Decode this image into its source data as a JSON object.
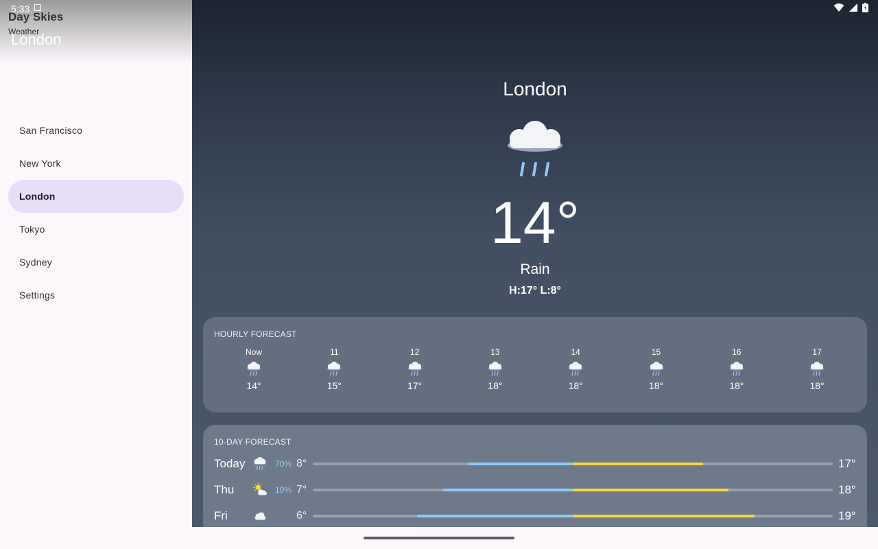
{
  "status": {
    "time": "5:33"
  },
  "drawer": {
    "app_name": "Day Skies",
    "app_subtitle": "Weather",
    "current_city": "London",
    "items": [
      {
        "label": "San Francisco",
        "active": false
      },
      {
        "label": "New York",
        "active": false
      },
      {
        "label": "London",
        "active": true
      },
      {
        "label": "Tokyo",
        "active": false
      },
      {
        "label": "Sydney",
        "active": false
      },
      {
        "label": "Settings",
        "active": false
      }
    ]
  },
  "current": {
    "city": "London",
    "temp": "14°",
    "condition": "Rain",
    "hilo": "H:17° L:8°",
    "icon": "rain-cloud-icon"
  },
  "hourly": {
    "title": "HOURLY FORECAST",
    "items": [
      {
        "label": "Now",
        "temp": "14°",
        "icon": "rain-cloud-icon"
      },
      {
        "label": "11",
        "temp": "15°",
        "icon": "rain-cloud-icon"
      },
      {
        "label": "12",
        "temp": "17°",
        "icon": "rain-cloud-icon"
      },
      {
        "label": "13",
        "temp": "18°",
        "icon": "rain-cloud-icon"
      },
      {
        "label": "14",
        "temp": "18°",
        "icon": "rain-cloud-icon"
      },
      {
        "label": "15",
        "temp": "18°",
        "icon": "rain-cloud-icon"
      },
      {
        "label": "16",
        "temp": "18°",
        "icon": "rain-cloud-icon"
      },
      {
        "label": "17",
        "temp": "18°",
        "icon": "rain-cloud-icon"
      }
    ]
  },
  "daily": {
    "title": "10-DAY FORECAST",
    "range_min": 2,
    "range_max": 22,
    "items": [
      {
        "day": "Today",
        "precip": "70%",
        "low": "8°",
        "high": "17°",
        "low_val": 8,
        "high_val": 17,
        "icon": "rain-cloud-icon"
      },
      {
        "day": "Thu",
        "precip": "10%",
        "low": "7°",
        "high": "18°",
        "low_val": 7,
        "high_val": 18,
        "icon": "partly-sunny-icon"
      },
      {
        "day": "Fri",
        "precip": "",
        "low": "6°",
        "high": "19°",
        "low_val": 6,
        "high_val": 19,
        "icon": "cloud-icon"
      }
    ]
  },
  "colors": {
    "cold": "#90caf9",
    "warm": "#fdd835"
  }
}
